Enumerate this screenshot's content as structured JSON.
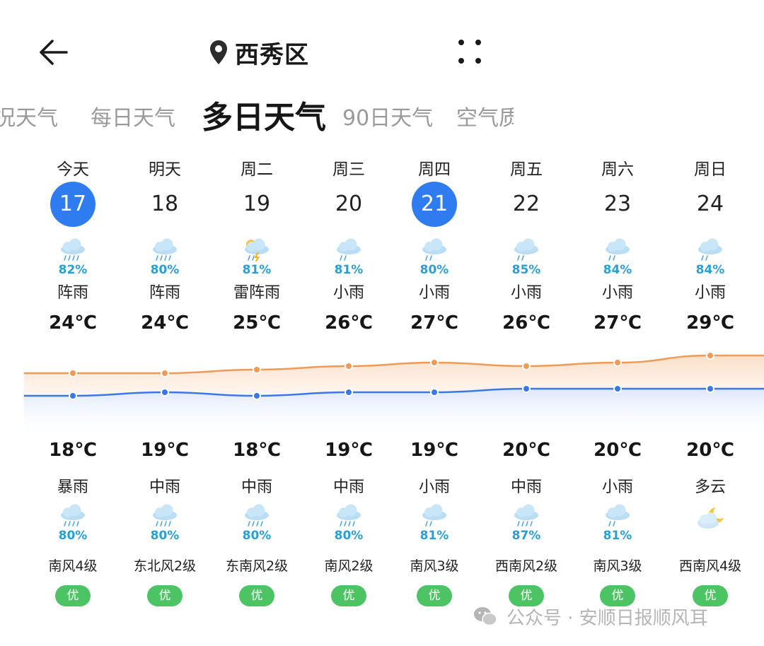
{
  "header": {
    "back_icon": "arrow-left-icon",
    "location_icon": "location-pin-icon",
    "location": "西秀区",
    "more_icon": "four-dots-icon"
  },
  "tabs": [
    {
      "label": "况天气",
      "active": false
    },
    {
      "label": "每日天气",
      "active": false
    },
    {
      "label": "多日天气",
      "active": true
    },
    {
      "label": "90日天气",
      "active": false
    },
    {
      "label": "空气质",
      "active": false
    }
  ],
  "colors": {
    "accent": "#2f7cf0",
    "high_line": "#f09a55",
    "low_line": "#3b78e7",
    "precip_text": "#2a9fd6",
    "aqi_good": "#4cc464"
  },
  "days": [
    {
      "weekday": "今天",
      "date": "17",
      "highlight": true,
      "day_icon": "shower-icon",
      "day_precip": "82%",
      "day_cond": "阵雨",
      "high": "24℃",
      "low": "18℃",
      "night_cond": "暴雨",
      "night_icon": "rainstorm-icon",
      "night_precip": "80%",
      "wind": "南风4级",
      "aqi": "优"
    },
    {
      "weekday": "明天",
      "date": "18",
      "highlight": false,
      "day_icon": "shower-icon",
      "day_precip": "80%",
      "day_cond": "阵雨",
      "high": "24℃",
      "low": "19℃",
      "night_cond": "中雨",
      "night_icon": "moderate-rain-icon",
      "night_precip": "80%",
      "wind": "东北风2级",
      "aqi": "优"
    },
    {
      "weekday": "周二",
      "date": "19",
      "highlight": false,
      "day_icon": "thunder-shower-icon",
      "day_precip": "81%",
      "day_cond": "雷阵雨",
      "high": "25℃",
      "low": "18℃",
      "night_cond": "中雨",
      "night_icon": "moderate-rain-icon",
      "night_precip": "80%",
      "wind": "东南风2级",
      "aqi": "优"
    },
    {
      "weekday": "周三",
      "date": "20",
      "highlight": false,
      "day_icon": "light-rain-icon",
      "day_precip": "81%",
      "day_cond": "小雨",
      "high": "26℃",
      "low": "19℃",
      "night_cond": "中雨",
      "night_icon": "moderate-rain-icon",
      "night_precip": "80%",
      "wind": "南风2级",
      "aqi": "优"
    },
    {
      "weekday": "周四",
      "date": "21",
      "highlight": true,
      "day_icon": "light-rain-icon",
      "day_precip": "80%",
      "day_cond": "小雨",
      "high": "27℃",
      "low": "19℃",
      "night_cond": "小雨",
      "night_icon": "light-rain-icon",
      "night_precip": "81%",
      "wind": "南风3级",
      "aqi": "优"
    },
    {
      "weekday": "周五",
      "date": "22",
      "highlight": false,
      "day_icon": "light-rain-icon",
      "day_precip": "85%",
      "day_cond": "小雨",
      "high": "26℃",
      "low": "20℃",
      "night_cond": "中雨",
      "night_icon": "moderate-rain-icon",
      "night_precip": "87%",
      "wind": "西南风2级",
      "aqi": "优"
    },
    {
      "weekday": "周六",
      "date": "23",
      "highlight": false,
      "day_icon": "light-rain-icon",
      "day_precip": "84%",
      "day_cond": "小雨",
      "high": "27℃",
      "low": "20℃",
      "night_cond": "小雨",
      "night_icon": "light-rain-icon",
      "night_precip": "81%",
      "wind": "南风3级",
      "aqi": "优"
    },
    {
      "weekday": "周日",
      "date": "24",
      "highlight": false,
      "day_icon": "light-rain-icon",
      "day_precip": "84%",
      "day_cond": "小雨",
      "high": "29℃",
      "low": "20℃",
      "night_cond": "多云",
      "night_icon": "partly-cloudy-night-icon",
      "night_precip": "",
      "wind": "西南风4级",
      "aqi": "优"
    }
  ],
  "chart_data": {
    "type": "line",
    "x": [
      "17",
      "18",
      "19",
      "20",
      "21",
      "22",
      "23",
      "24"
    ],
    "series": [
      {
        "values": [
          24,
          24,
          25,
          26,
          27,
          26,
          27,
          29
        ]
      },
      {
        "values": [
          18,
          19,
          18,
          19,
          19,
          20,
          20,
          20
        ]
      }
    ]
  },
  "footer": {
    "icon": "wechat-icon",
    "text": "公众号 · 安顺日报顺风耳"
  }
}
